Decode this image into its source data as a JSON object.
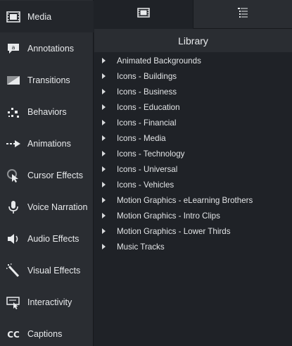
{
  "sidebar": {
    "items": [
      {
        "label": "Media",
        "icon": "film-strip-icon",
        "active": true
      },
      {
        "label": "Annotations",
        "icon": "annotation-bubble-icon"
      },
      {
        "label": "Transitions",
        "icon": "transition-icon"
      },
      {
        "label": "Behaviors",
        "icon": "behaviors-icon"
      },
      {
        "label": "Animations",
        "icon": "animation-arrow-icon"
      },
      {
        "label": "Cursor Effects",
        "icon": "cursor-effects-icon"
      },
      {
        "label": "Voice Narration",
        "icon": "microphone-icon"
      },
      {
        "label": "Audio Effects",
        "icon": "speaker-icon"
      },
      {
        "label": "Visual Effects",
        "icon": "magic-wand-icon"
      },
      {
        "label": "Interactivity",
        "icon": "interactivity-icon"
      },
      {
        "label": "Captions",
        "icon": "captions-cc-icon"
      }
    ]
  },
  "tabs": [
    {
      "icon": "film-strip-icon",
      "active": true
    },
    {
      "icon": "library-list-icon",
      "active": false
    }
  ],
  "library": {
    "title": "Library",
    "items": [
      "Animated Backgrounds",
      "Icons - Buildings",
      "Icons - Business",
      "Icons - Education",
      "Icons - Financial",
      "Icons - Media",
      "Icons - Technology",
      "Icons - Universal",
      "Icons - Vehicles",
      "Motion Graphics - eLearning Brothers",
      "Motion Graphics - Intro Clips",
      "Motion Graphics - Lower Thirds",
      "Music Tracks"
    ]
  },
  "colors": {
    "sidebar_bg": "#2a2d32",
    "panel_bg": "#1f2227",
    "text": "#e6e8ea"
  }
}
